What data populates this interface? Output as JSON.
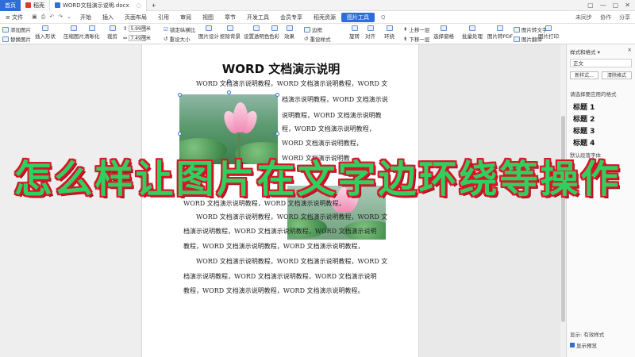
{
  "titlebar": {
    "home": "首页",
    "tab1": "稻壳",
    "tab2": "WORD文档演示说明.docx",
    "add": "+",
    "right": [
      "▢",
      "—",
      "▢",
      "✕"
    ]
  },
  "menubar": {
    "file": "≡ 文件",
    "items": [
      "开始",
      "插入",
      "页面布局",
      "引用",
      "审阅",
      "视图",
      "章节",
      "开发工具",
      "会员专享",
      "稻壳资源",
      "图片工具"
    ],
    "selected_index": 10,
    "search": "Q",
    "right": [
      "未同步",
      "协作",
      "分享"
    ]
  },
  "ribbon": {
    "add_image": "添加图片",
    "replace_image": "替换图片",
    "insert_shape": "插入形状",
    "compress": "压缩图片",
    "clear": "清晰化",
    "crop": "裁剪",
    "height": "5.99厘米",
    "width": "7.49厘米",
    "lock_ratio": "锁定纵横比",
    "reset_size": "重设大小",
    "image_design": "图片设计",
    "remove_bg": "抠除背景",
    "set_transparent": "设置透明色",
    "color": "色彩",
    "effect": "效果",
    "border": "边框",
    "reset_style": "重设样式",
    "rotate": "旋转",
    "align": "对齐",
    "wrap": "环绕",
    "up": "上移一层",
    "down": "下移一层",
    "select_pane": "选择窗格",
    "batch": "批量处理",
    "to_pdf": "图片转PDF",
    "to_text": "图片转文字",
    "translate": "图片翻译",
    "print": "图片打印"
  },
  "document": {
    "title": "WORD 文档演示说明",
    "lines": [
      "WORD 文档演示说明教程，WORD 文档演示说明教程，WORD 文",
      "档演示说明教程，WORD 文档演示说",
      "说明教程，WORD 文档演示说明教",
      "程，WORD 文档演示说明教程，",
      "WORD 文档演示说明教程，",
      "WORD 文档演示说明教",
      "WORD 文档演示说明教程，WORD 文档演示说明教程，",
      "WORD 文档演示说明教程，WORD 文档演示说明教程，WORD 文",
      "档演示说明教程，WORD 文档演示说明教程，WORD 文档演示说明",
      "教程，WORD 文档演示说明教程，WORD 文档演示说明教程，",
      "WORD 文档演示说明教程，WORD 文档演示说明教程，WORD 文",
      "档演示说明教程，WORD 文档演示说明教程，WORD 文档演示说明",
      "教程，WORD 文档演示说明教程，WORD 文档演示说明教程。"
    ]
  },
  "overlay_text": "怎么样让图片在文字边环绕等操作",
  "panel": {
    "header": "样式和格式 ▾",
    "current": "正文",
    "new_style": "新样式...",
    "clear_format": "清除格式",
    "prompt": "请选择要应用的格式",
    "headings": [
      "标题 1",
      "标题 2",
      "标题 3",
      "标题 4"
    ],
    "default_font": "默认段落字体",
    "show_label": "显示: 有效样式",
    "preview": "显示预览"
  }
}
